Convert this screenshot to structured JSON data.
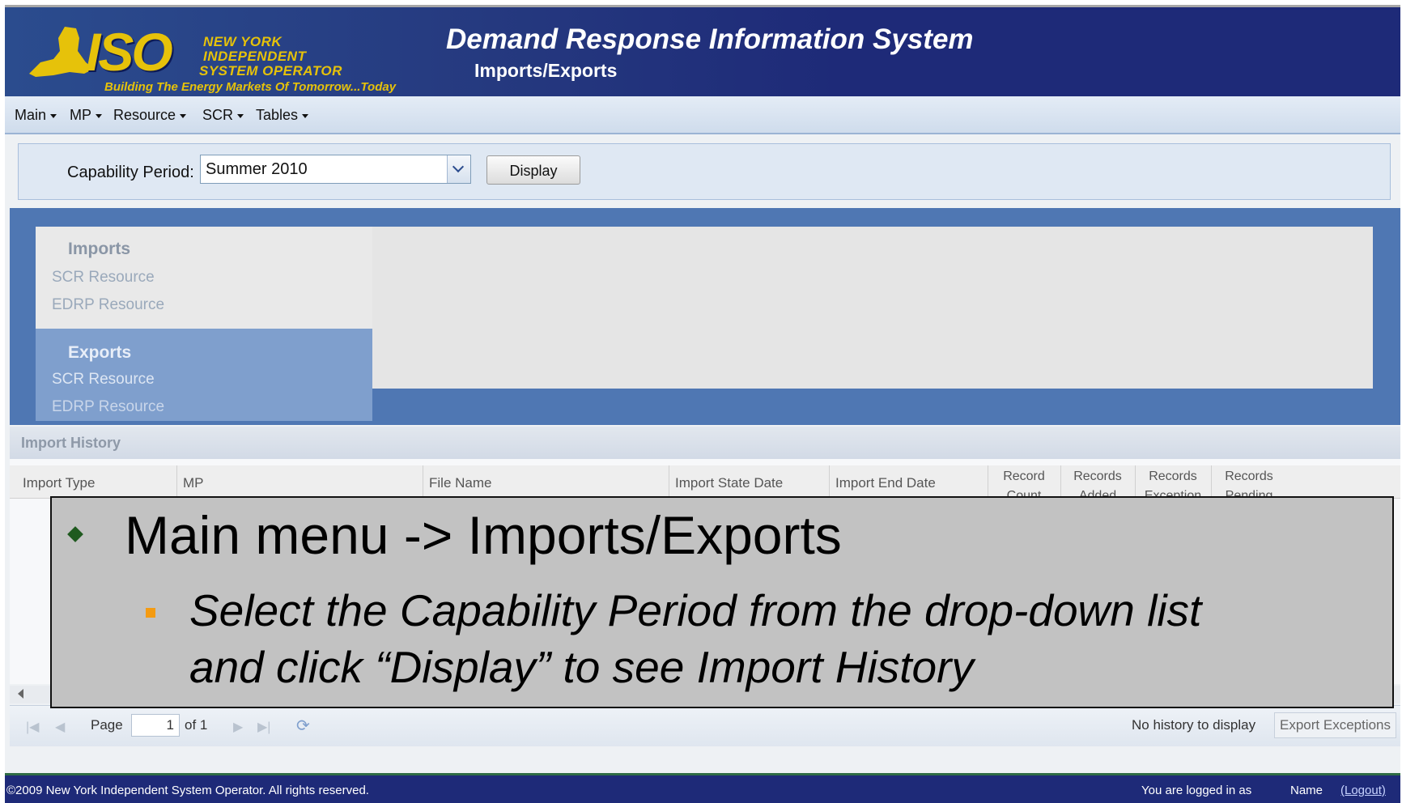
{
  "header": {
    "logo": {
      "iso": "ISO",
      "line1": "NEW YORK",
      "line2": "INDEPENDENT",
      "line3": "SYSTEM OPERATOR",
      "tagline": "Building The Energy Markets Of Tomorrow...Today"
    },
    "title": "Demand Response Information System",
    "subtitle": "Imports/Exports"
  },
  "menu": {
    "items": [
      {
        "label": "Main"
      },
      {
        "label": "MP"
      },
      {
        "label": "Resource"
      },
      {
        "label": "SCR"
      },
      {
        "label": "Tables"
      }
    ]
  },
  "filter": {
    "label": "Capability Period:",
    "selected": "Summer 2010",
    "button": "Display"
  },
  "nav": {
    "imports": {
      "heading": "Imports",
      "items": [
        "SCR Resource",
        "EDRP Resource"
      ]
    },
    "exports": {
      "heading": "Exports",
      "items": [
        "SCR Resource",
        "EDRP Resource"
      ]
    }
  },
  "history": {
    "title": "Import History",
    "columns": [
      "Import Type",
      "MP",
      "File Name",
      "Import State Date",
      "Import End Date",
      "Record Count",
      "Records Added",
      "Records Exception",
      "Records Pending"
    ]
  },
  "pager": {
    "page_label": "Page",
    "page_value": "1",
    "of_label": "of 1",
    "status": "No history to display",
    "export_button": "Export Exceptions"
  },
  "footer": {
    "copyright": "©2009   New York Independent System Operator. All rights reserved.",
    "logged_in": "You are logged in as",
    "user": "Name",
    "logout": "(Logout)"
  },
  "callout": {
    "heading": "Main menu -> Imports/Exports",
    "line_a": "Select the Capability Period from the drop-down list",
    "line_b": "and click “Display” to see Import History"
  },
  "colors": {
    "banner": "#1e2a78",
    "logo_gold": "#e6c20a",
    "panel_blue": "#4f77b3",
    "callout_bg": "#c2c2c2",
    "bullet_main": "#1f5a1f",
    "bullet_sub": "#f49b12"
  }
}
